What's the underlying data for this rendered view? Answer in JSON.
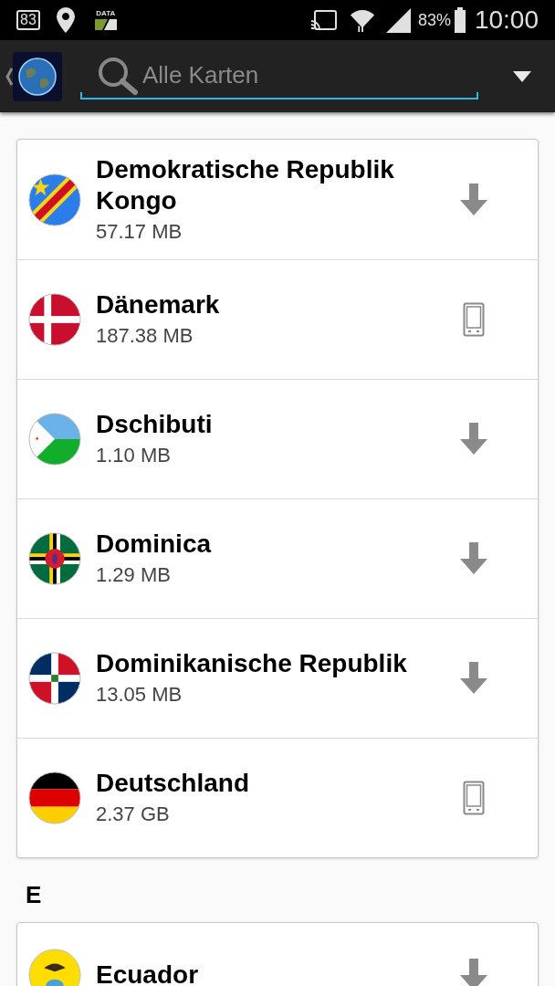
{
  "status_bar": {
    "battery_badge": "83",
    "data_label": "DATA",
    "battery_percent": "83%",
    "time": "10:00"
  },
  "toolbar": {
    "search": {
      "placeholder": "Alle Karten"
    }
  },
  "sections": [
    {
      "items": [
        {
          "name": "Demokratische Republik Kongo",
          "size": "57.17 MB",
          "kind": "download"
        },
        {
          "name": "Dänemark",
          "size": "187.38 MB",
          "kind": "device"
        },
        {
          "name": "Dschibuti",
          "size": "1.10 MB",
          "kind": "download"
        },
        {
          "name": "Dominica",
          "size": "1.29 MB",
          "kind": "download"
        },
        {
          "name": "Dominikanische Republik",
          "size": "13.05 MB",
          "kind": "download"
        },
        {
          "name": "Deutschland",
          "size": "2.37 GB",
          "kind": "device"
        }
      ]
    },
    {
      "letter": "E",
      "items": [
        {
          "name": "Ecuador",
          "kind": "download"
        }
      ]
    }
  ]
}
